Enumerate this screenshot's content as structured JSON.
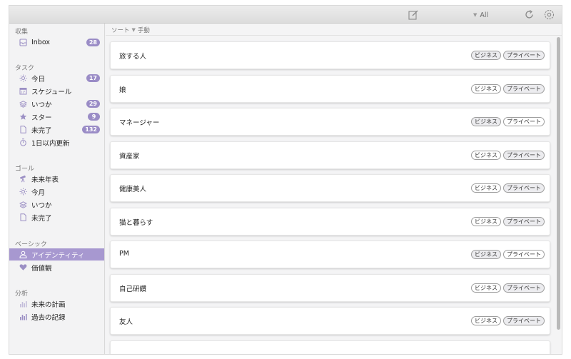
{
  "toolbar": {
    "filter_label": "All"
  },
  "sidebar": {
    "sections": {
      "collect": "収集",
      "tasks": "タスク",
      "goals": "ゴール",
      "basic": "ベーシック",
      "analysis": "分析"
    },
    "items": [
      {
        "label": "Inbox",
        "badge": "28",
        "icon": "inbox-icon"
      },
      {
        "label": "今日",
        "badge": "17",
        "icon": "sun-icon"
      },
      {
        "label": "スケジュール",
        "badge": "",
        "icon": "calendar-icon"
      },
      {
        "label": "いつか",
        "badge": "29",
        "icon": "layers-icon"
      },
      {
        "label": "スター",
        "badge": "9",
        "icon": "star-icon"
      },
      {
        "label": "未完了",
        "badge": "132",
        "icon": "document-icon"
      },
      {
        "label": "1日以内更新",
        "badge": "",
        "icon": "timer-icon"
      },
      {
        "label": "未来年表",
        "badge": "",
        "icon": "telescope-icon"
      },
      {
        "label": "今月",
        "badge": "",
        "icon": "sun-icon"
      },
      {
        "label": "いつか",
        "badge": "",
        "icon": "layers-icon"
      },
      {
        "label": "未完了",
        "badge": "",
        "icon": "document-icon"
      },
      {
        "label": "アイデンティティ",
        "badge": "",
        "icon": "person-icon"
      },
      {
        "label": "価値観",
        "badge": "",
        "icon": "heart-icon"
      },
      {
        "label": "未来の計画",
        "badge": "",
        "icon": "bar-chart-icon"
      },
      {
        "label": "過去の記録",
        "badge": "",
        "icon": "bar-chart-icon"
      }
    ]
  },
  "main": {
    "sort_label": "ソート",
    "sort_value": "手動",
    "tag_business": "ビジネス",
    "tag_private": "プライベート",
    "cards": [
      {
        "title": "旅する人"
      },
      {
        "title": "娘"
      },
      {
        "title": "マネージャー"
      },
      {
        "title": "資産家"
      },
      {
        "title": "健康美人"
      },
      {
        "title": "猫と暮らす"
      },
      {
        "title": "PM"
      },
      {
        "title": "自己研鑽"
      },
      {
        "title": "友人"
      }
    ]
  }
}
